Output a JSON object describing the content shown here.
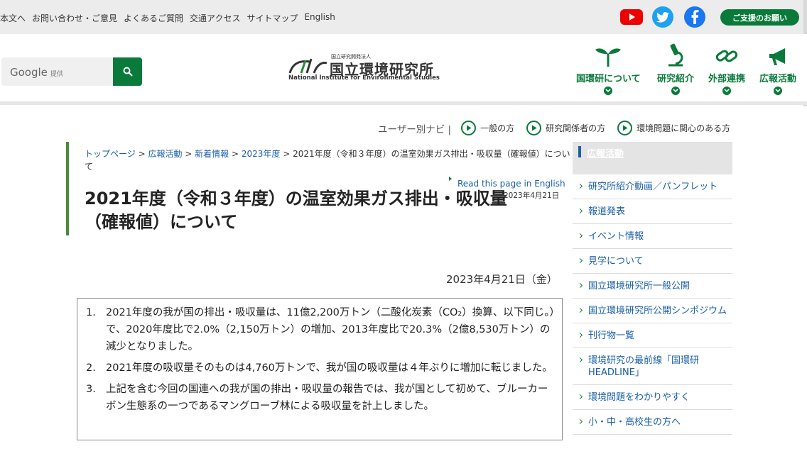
{
  "top_links": [
    "本文へ",
    "お問い合わせ・ご意見",
    "よくあるご質問",
    "交通アクセス",
    "サイトマップ",
    "English"
  ],
  "social": {
    "youtube": "youtube-icon",
    "twitter": "twitter-icon",
    "facebook": "facebook-icon"
  },
  "support_button": "ご支援のお願い",
  "search": {
    "brand": "Google",
    "provided": "提供",
    "placeholder": ""
  },
  "logo": {
    "top": "国立研究開発法人",
    "main": "国立環境研究所",
    "en": "National Institute for Environmental Studies"
  },
  "gnav": [
    {
      "label": "国環研について",
      "icon": "sprout-icon"
    },
    {
      "label": "研究紹介",
      "icon": "microscope-icon"
    },
    {
      "label": "外部連携",
      "icon": "link-icon"
    },
    {
      "label": "広報活動",
      "icon": "megaphone-icon"
    }
  ],
  "user_navi": {
    "title": "ユーザー別ナビ |",
    "items": [
      "一般の方",
      "研究関係者の方",
      "環境問題に関心のある方"
    ]
  },
  "breadcrumb": [
    "トップページ",
    "広報活動",
    "新着情報",
    "2023年度",
    "2021年度（令和３年度）の温室効果ガス排出・吸収量（確報値）について"
  ],
  "read_english": "Read this page in English",
  "small_date": "2023年4月21日",
  "title": "2021年度（令和３年度）の温室効果ガス排出・吸収量（確報値）について",
  "page_date": "2023年4月21日（金）",
  "summary": [
    {
      "num": "1.",
      "text": "2021年度の我が国の排出・吸収量は、11億2,200万トン（二酸化炭素（CO₂）換算、以下同じ。）で、2020年度比で2.0%（2,150万トン）の増加、2013年度比で20.3%（2億8,530万トン）の減少となりました。"
    },
    {
      "num": "2.",
      "text": "2021年度の吸収量そのものは4,760万トンで、我が国の吸収量は４年ぶりに増加に転じました。"
    },
    {
      "num": "3.",
      "text": "上記を含む今回の国連への我が国の排出・吸収量の報告では、我が国として初めて、ブルーカーボン生態系の一つであるマングローブ林による吸収量を計上しました。"
    }
  ],
  "side": {
    "heading": "広報活動",
    "items": [
      "研究所紹介動画／パンフレット",
      "報道発表",
      "イベント情報",
      "見学について",
      "国立環境研究所一般公開",
      "国立環境研究所公開シンポジウム",
      "刊行物一覧",
      "環境研究の最前線「国環研HEADLINE」",
      "環境問題をわかりやすく",
      "小・中・高校生の方へ"
    ]
  },
  "colors": {
    "brand_green": "#0a7a3a",
    "link_blue": "#1a5fa8",
    "youtube": "#e00000",
    "twitter": "#1da1f2",
    "facebook": "#1877f2"
  }
}
